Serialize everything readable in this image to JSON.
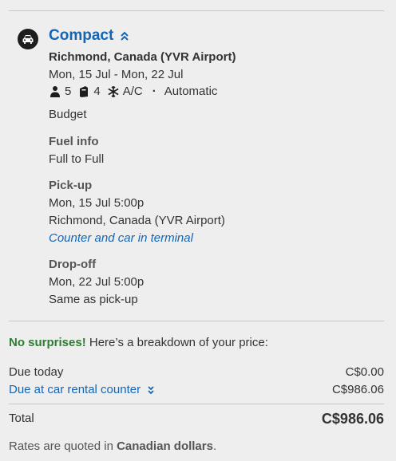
{
  "car": {
    "class_name": "Compact",
    "location": "Richmond, Canada (YVR Airport)",
    "dates": "Mon, 15 Jul - Mon, 22 Jul",
    "features": {
      "passengers": "5",
      "bags": "4",
      "ac": "A/C",
      "transmission": "Automatic"
    },
    "vendor": "Budget"
  },
  "fuel": {
    "label": "Fuel info",
    "value": "Full to Full"
  },
  "pickup": {
    "label": "Pick-up",
    "datetime": "Mon, 15 Jul 5:00p",
    "location": "Richmond, Canada (YVR Airport)",
    "note": "Counter and car in terminal"
  },
  "dropoff": {
    "label": "Drop-off",
    "datetime": "Mon, 22 Jul 5:00p",
    "location": "Same as pick-up"
  },
  "price": {
    "headline_bold": "No surprises!",
    "headline_rest": " Here’s a breakdown of your price:",
    "due_today_label": "Due today",
    "due_today_value": "C$0.00",
    "due_counter_label": "Due at car rental counter",
    "due_counter_value": "C$986.06",
    "total_label": "Total",
    "total_value": "C$986.06",
    "rates_prefix": "Rates are quoted in ",
    "rates_currency": "Canadian dollars",
    "rates_suffix": "."
  },
  "colors": {
    "link": "#1565b4",
    "accent_green": "#2e7d32",
    "background": "#eeeeee"
  },
  "icons": [
    "car-icon",
    "chevrons-up-icon",
    "person-icon",
    "bag-icon",
    "snowflake-icon",
    "chevrons-down-icon"
  ]
}
